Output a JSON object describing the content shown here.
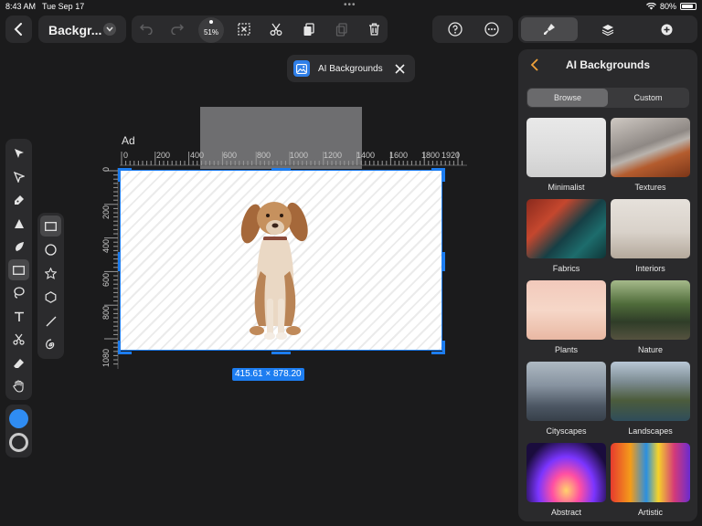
{
  "status_bar": {
    "time": "8:43 AM",
    "date": "Tue Sep 17",
    "battery": "80%"
  },
  "toolbar": {
    "doc_title": "Backgr...",
    "zoom": "51%"
  },
  "popover": {
    "label": "AI Backgrounds"
  },
  "canvas": {
    "artboard_label": "Ad",
    "ruler_top": [
      "0",
      "200",
      "400",
      "600",
      "800",
      "1000",
      "1200",
      "1400",
      "1600",
      "1800",
      "1920"
    ],
    "ruler_left": [
      "0",
      "200",
      "400",
      "600",
      "800",
      "1080"
    ],
    "dimensions": "415.61 × 878.20"
  },
  "panel": {
    "title": "AI Backgrounds",
    "segments": [
      "Browse",
      "Custom"
    ],
    "active_segment": "Browse",
    "categories": [
      {
        "label": "Minimalist",
        "thumb": "t-min"
      },
      {
        "label": "Textures",
        "thumb": "t-tex"
      },
      {
        "label": "Fabrics",
        "thumb": "t-fab"
      },
      {
        "label": "Interiors",
        "thumb": "t-int"
      },
      {
        "label": "Plants",
        "thumb": "t-pla"
      },
      {
        "label": "Nature",
        "thumb": "t-nat"
      },
      {
        "label": "Cityscapes",
        "thumb": "t-cit"
      },
      {
        "label": "Landscapes",
        "thumb": "t-lan"
      },
      {
        "label": "Abstract",
        "thumb": "t-abs"
      },
      {
        "label": "Artistic",
        "thumb": "t-art"
      }
    ]
  },
  "colors": {
    "accent": "#1d7df0",
    "fill_swatch": "#2f8cf2",
    "panel_back": "#f0a23a"
  },
  "icons": {
    "top": [
      "back-icon",
      "chevron-down-icon",
      "undo-icon",
      "redo-icon",
      "deselect-icon",
      "cut-icon",
      "paste-icon",
      "copy-icon",
      "trash-icon",
      "help-icon",
      "more-icon",
      "brush-icon",
      "layers-icon",
      "add-icon"
    ],
    "tools": [
      "select-icon",
      "direct-select-icon",
      "pen-icon",
      "vector-brush-icon",
      "brush-icon",
      "rectangle-icon",
      "lasso-icon",
      "text-icon",
      "scissors-icon",
      "eraser-icon",
      "hand-icon"
    ],
    "shapes": [
      "rectangle-icon",
      "ellipse-icon",
      "star-icon",
      "polygon-icon",
      "line-icon",
      "spiral-icon"
    ]
  }
}
